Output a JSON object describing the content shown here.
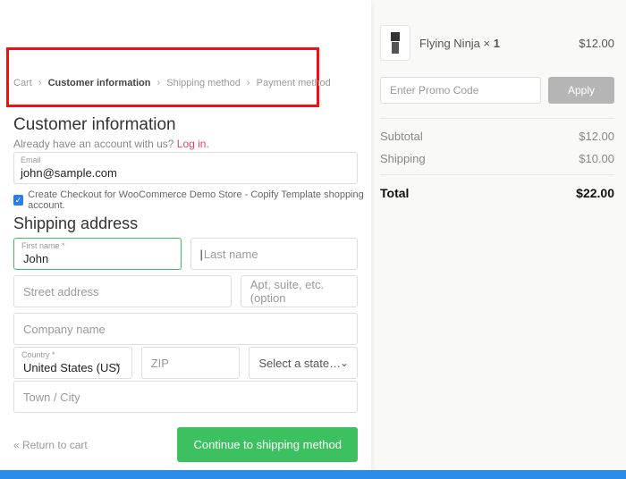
{
  "breadcrumb": {
    "cart": "Cart",
    "customer_info": "Customer information",
    "shipping_method": "Shipping method",
    "payment_method": "Payment method"
  },
  "customer_info": {
    "heading": "Customer information",
    "already_text": "Already have an account with us? ",
    "login_text": "Log in.",
    "email_label": "Email",
    "email_value": "john@sample.com",
    "checkbox_label": "Create Checkout for WooCommerce Demo Store - Copify Template shopping account."
  },
  "shipping": {
    "heading": "Shipping address",
    "first_name_label": "First name *",
    "first_name_value": "John",
    "last_name_placeholder": "Last name",
    "street_placeholder": "Street address",
    "apt_placeholder": "Apt, suite, etc. (option",
    "company_placeholder": "Company name",
    "country_label": "Country *",
    "country_value": "United States (US)",
    "zip_placeholder": "ZIP",
    "state_placeholder": "Select a state…",
    "town_placeholder": "Town / City"
  },
  "footer": {
    "return": "« Return to cart",
    "continue": "Continue to shipping method"
  },
  "summary": {
    "item_name": "Flying Ninja × ",
    "item_qty": "1",
    "item_price": "$12.00",
    "promo_placeholder": "Enter Promo Code",
    "apply": "Apply",
    "subtotal_label": "Subtotal",
    "subtotal_value": "$12.00",
    "shipping_label": "Shipping",
    "shipping_value": "$10.00",
    "total_label": "Total",
    "total_value": "$22.00"
  }
}
